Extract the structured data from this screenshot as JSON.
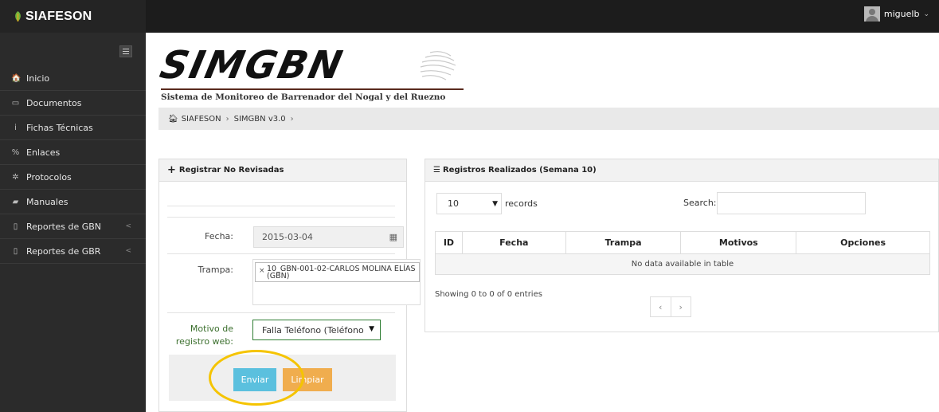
{
  "brand": {
    "title": "SIAFESON"
  },
  "user": {
    "name": "miguelb"
  },
  "sidebar": {
    "items": [
      {
        "label": "Inicio",
        "icon": "home-icon",
        "glyph": "🏠",
        "arrow": ""
      },
      {
        "label": "Documentos",
        "icon": "folder-icon",
        "glyph": "▭",
        "arrow": ""
      },
      {
        "label": "Fichas Técnicas",
        "icon": "info-icon",
        "glyph": "i",
        "arrow": ""
      },
      {
        "label": "Enlaces",
        "icon": "link-icon",
        "glyph": "%",
        "arrow": ""
      },
      {
        "label": "Protocolos",
        "icon": "gear-icon",
        "glyph": "✲",
        "arrow": ""
      },
      {
        "label": "Manuales",
        "icon": "book-icon",
        "glyph": "▰",
        "arrow": ""
      },
      {
        "label": "Reportes de GBN",
        "icon": "file-icon",
        "glyph": "▯",
        "arrow": "<"
      },
      {
        "label": "Reportes de GBR",
        "icon": "file-icon",
        "glyph": "▯",
        "arrow": "<"
      }
    ]
  },
  "header": {
    "logo_text": "SIMGBN",
    "subtitle": "Sistema de Monitoreo de Barrenador del Nogal y del Ruezno"
  },
  "breadcrumb": {
    "items": [
      "SIAFESON",
      "SIMGBN v3.0"
    ],
    "sep": "›"
  },
  "form": {
    "title": "Registrar No Revisadas",
    "fecha_label": "Fecha:",
    "fecha_value": "2015-03-04",
    "trampa_label": "Trampa:",
    "trampa_tag": "10_GBN-001-02-CARLOS MOLINA ELÍAS (GBN)",
    "motivo_label": "Motivo de registro web:",
    "motivo_value": "Falla Teléfono (Teléfono",
    "enviar": "Enviar",
    "limpiar": "Limpiar"
  },
  "registros": {
    "title": "Registros Realizados (Semana 10)",
    "page_size": "10",
    "records_label": "records",
    "search_label": "Search:",
    "search_value": "",
    "columns": [
      "ID",
      "Fecha",
      "Trampa",
      "Motivos",
      "Opciones"
    ],
    "empty": "No data available in table",
    "showing": "Showing 0 to 0 of 0 entries",
    "prev": "‹",
    "next": "›"
  },
  "colors": {
    "accent_info": "#5bc0de",
    "accent_warning": "#f0ad4e",
    "highlight": "#f5c400"
  }
}
